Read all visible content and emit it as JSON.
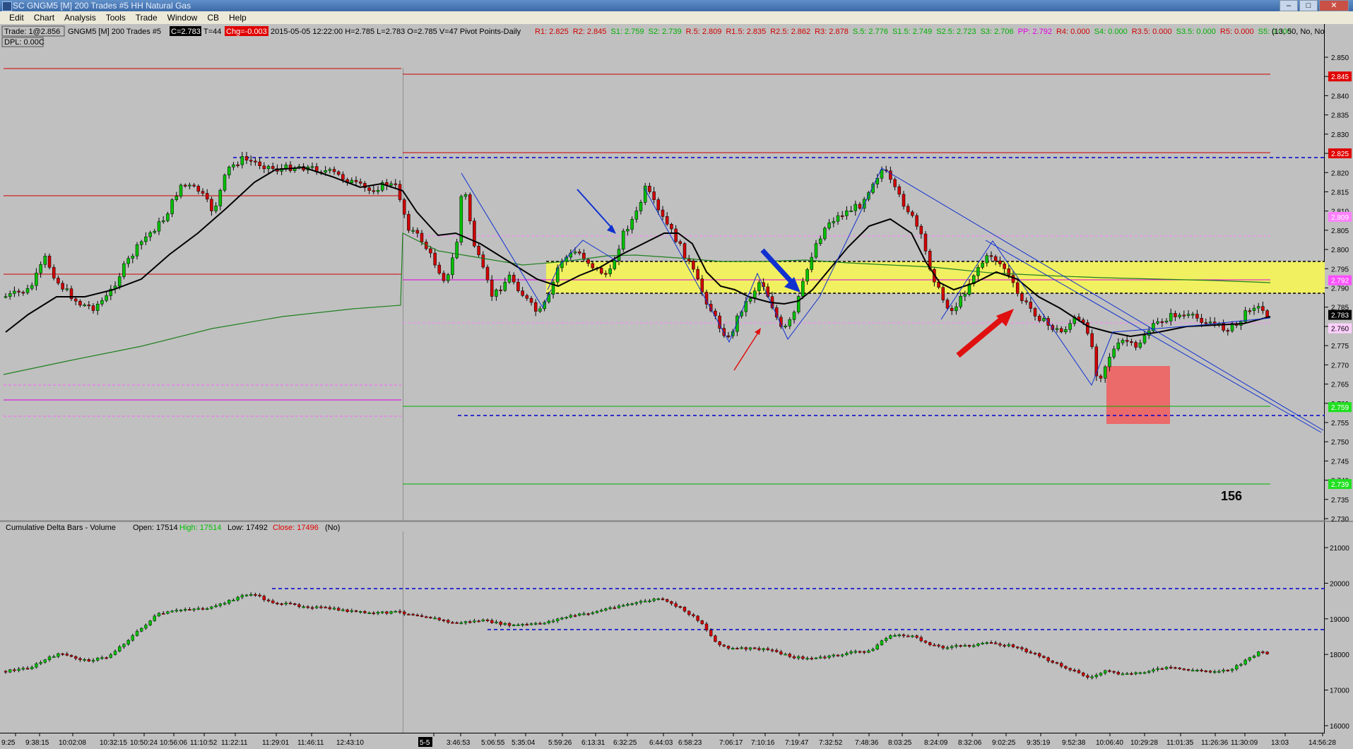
{
  "window": {
    "title": "SC GNGM5 [M]  200 Trades  #5  HH Natural Gas"
  },
  "menu": [
    "Edit",
    "Chart",
    "Analysis",
    "Tools",
    "Trade",
    "Window",
    "CB",
    "Help"
  ],
  "header": {
    "trade_box": "Trade: 1@2.856",
    "dpl": "DPL: 0.00C",
    "info_prefix": "GNGM5 [M]  200 Trades  #5",
    "close_badge": "C=2.783",
    "ticks": "T=44",
    "chg_badge": "Chg=-0.003",
    "bar_info": "2015-05-05 12:22:00 H=2.785 L=2.783 O=2.785 V=47 Pivot Points-Daily",
    "pivots": [
      {
        "text": "R1: 2.825",
        "color": "#d00000"
      },
      {
        "text": "R2: 2.845",
        "color": "#d00000"
      },
      {
        "text": "S1: 2.759",
        "color": "#00b000"
      },
      {
        "text": "S2: 2.739",
        "color": "#00b000"
      },
      {
        "text": "R.5: 2.809",
        "color": "#d00000"
      },
      {
        "text": "R1.5: 2.835",
        "color": "#d00000"
      },
      {
        "text": "R2.5: 2.862",
        "color": "#d00000"
      },
      {
        "text": "R3: 2.878",
        "color": "#d00000"
      },
      {
        "text": "S.5: 2.776",
        "color": "#00b000"
      },
      {
        "text": "S1.5: 2.749",
        "color": "#00b000"
      },
      {
        "text": "S2.5: 2.723",
        "color": "#00b000"
      },
      {
        "text": "S3: 2.706",
        "color": "#00b000"
      },
      {
        "text": "PP: 2.792",
        "color": "#e000e0"
      },
      {
        "text": "R4: 0.000",
        "color": "#d00000"
      },
      {
        "text": "S4: 0.000",
        "color": "#00b000"
      },
      {
        "text": "R3.5: 0.000",
        "color": "#d00000"
      },
      {
        "text": "S3.5: 0.000",
        "color": "#00b000"
      },
      {
        "text": "R5: 0.000",
        "color": "#d00000"
      },
      {
        "text": "S5: 0.000",
        "color": "#00b000"
      }
    ],
    "params": "(13, 50, No, No"
  },
  "price_axis": {
    "labels": [
      "2.850",
      "2.845",
      "2.840",
      "2.835",
      "2.830",
      "2.825",
      "2.820",
      "2.815",
      "2.810",
      "2.805",
      "2.800",
      "2.795",
      "2.790",
      "2.785",
      "2.780",
      "2.775",
      "2.770",
      "2.765",
      "2.760",
      "2.755",
      "2.750",
      "2.745",
      "2.740",
      "2.735",
      "2.730"
    ],
    "tags": [
      {
        "text": "2.845",
        "price": 2.845,
        "bg": "#e00000",
        "fg": "#ffffff"
      },
      {
        "text": "2.825",
        "price": 2.825,
        "bg": "#e00000",
        "fg": "#ffffff"
      },
      {
        "text": "2.809",
        "price": 2.8085,
        "bg": "#ff80ff",
        "fg": "#ffffff"
      },
      {
        "text": "2.792",
        "price": 2.792,
        "bg": "#ff50ff",
        "fg": "#ffffff"
      },
      {
        "text": "2.783",
        "price": 2.783,
        "bg": "#000000",
        "fg": "#ffffff"
      },
      {
        "text": "2.760",
        "price": 2.7795,
        "bg": "#ffd0ff",
        "fg": "#000000"
      },
      {
        "text": "2.759",
        "price": 2.759,
        "bg": "#20e020",
        "fg": "#ffffff"
      },
      {
        "text": "2.739",
        "price": 2.739,
        "bg": "#20e020",
        "fg": "#ffffff"
      }
    ]
  },
  "annotation_number": "156",
  "delta_panel": {
    "header": "Cumulative Delta Bars - Volume",
    "open": "Open: 17514",
    "high": "High: 17514",
    "low": "Low: 17492",
    "close": "Close: 17496",
    "no": "(No)",
    "axis_labels": [
      "21000",
      "20000",
      "19000",
      "18000",
      "17000",
      "16000"
    ]
  },
  "time_axis": {
    "labels": [
      "9:25",
      "9:38:15",
      "10:02:08",
      "10:32:15",
      "10:50:24",
      "10:56:06",
      "11:10:52",
      "11:22:11",
      "11:29:01",
      "11:46:11",
      "12:43:10",
      "5-5",
      "3:46:53",
      "5:06:55",
      "5:35:04",
      "5:59:26",
      "6:13:31",
      "6:32:25",
      "6:44:03",
      "6:58:23",
      "7:06:17",
      "7:10:16",
      "7:19:47",
      "7:32:52",
      "7:48:36",
      "8:03:25",
      "8:24:09",
      "8:32:06",
      "9:02:25",
      "9:35:19",
      "9:52:38",
      "10:06:40",
      "10:29:28",
      "11:01:35",
      "11:26:36",
      "11:30:09",
      "13:03",
      "14:56:28"
    ]
  },
  "colors": {
    "background": "#c0c0c0",
    "up_candle": "#00c000",
    "down_candle": "#d00000",
    "ma_black": "#000000",
    "ma_green": "#208020",
    "pivot_zone": "#f0f060",
    "target_box": "#f06060"
  }
}
